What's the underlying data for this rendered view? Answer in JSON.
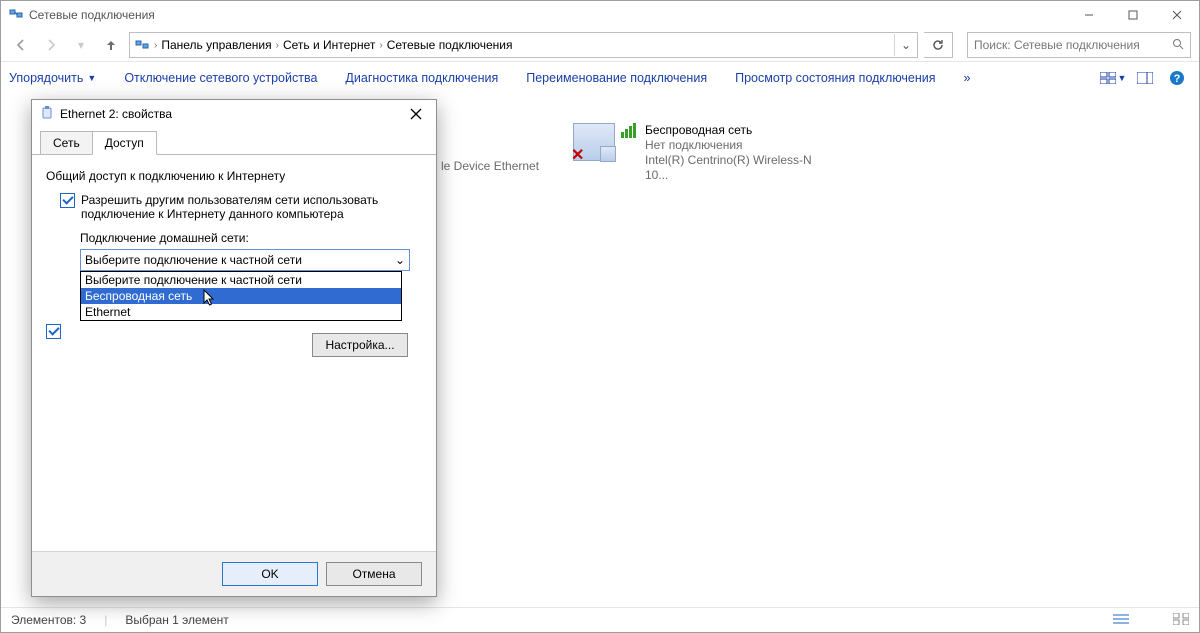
{
  "window": {
    "title": "Сетевые подключения",
    "minimize": "—",
    "maximize": "▢",
    "close": "✕"
  },
  "breadcrumb": {
    "items": [
      "Панель управления",
      "Сеть и Интернет",
      "Сетевые подключения"
    ]
  },
  "search": {
    "placeholder": "Поиск: Сетевые подключения"
  },
  "toolbar": {
    "organize": "Упорядочить",
    "disable": "Отключение сетевого устройства",
    "diagnose": "Диагностика подключения",
    "rename": "Переименование подключения",
    "status": "Просмотр состояния подключения",
    "more": "»"
  },
  "connections": {
    "partial_label": "le Device Ethernet",
    "wireless": {
      "name": "Беспроводная сеть",
      "status": "Нет подключения",
      "device": "Intel(R) Centrino(R) Wireless-N 10..."
    }
  },
  "statusbar": {
    "elements": "Элементов: 3",
    "selected": "Выбран 1 элемент"
  },
  "dialog": {
    "title": "Ethernet 2: свойства",
    "tab_network": "Сеть",
    "tab_sharing": "Доступ",
    "group_title": "Общий доступ к подключению к Интернету",
    "allow_label": "Разрешить другим пользователям сети использовать подключение к Интернету данного компьютера",
    "home_conn_label": "Подключение домашней сети:",
    "combo_selected": "Выберите подключение к частной сети",
    "combo_options": [
      "Выберите подключение к частной сети",
      "Беспроводная сеть",
      "Ethernet"
    ],
    "settings_btn": "Настройка...",
    "ok": "OK",
    "cancel": "Отмена"
  }
}
